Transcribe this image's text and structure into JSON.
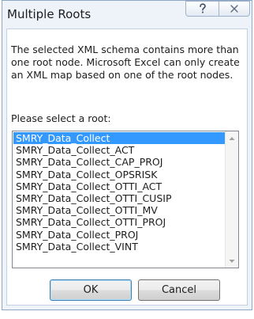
{
  "dialog": {
    "title": "Multiple Roots"
  },
  "message": "The selected XML schema contains more than one root node. Microsoft Excel can only create an XML map based on one of the root nodes.",
  "prompt": "Please select a root:",
  "roots": [
    "SMRY_Data_Collect",
    "SMRY_Data_Collect_ACT",
    "SMRY_Data_Collect_CAP_PROJ",
    "SMRY_Data_Collect_OPSRISK",
    "SMRY_Data_Collect_OTTI_ACT",
    "SMRY_Data_Collect_OTTI_CUSIP",
    "SMRY_Data_Collect_OTTI_MV",
    "SMRY_Data_Collect_OTTI_PROJ",
    "SMRY_Data_Collect_PROJ",
    "SMRY_Data_Collect_VINT"
  ],
  "selected_root": "SMRY_Data_Collect",
  "buttons": {
    "ok": "OK",
    "cancel": "Cancel"
  },
  "titlebar_icons": {
    "help": "question-icon",
    "close": "close-icon"
  }
}
